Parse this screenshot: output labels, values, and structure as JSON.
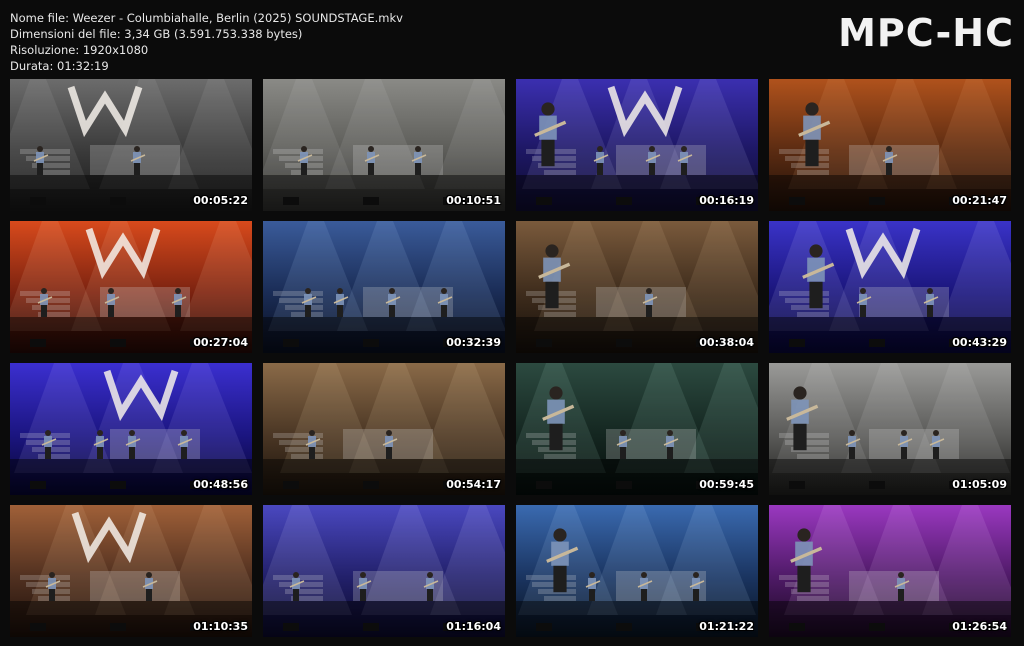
{
  "info": {
    "filename": "Nome file: Weezer - Columbiahalle, Berlin (2025) SOUNDSTAGE.mkv",
    "filesize": "Dimensioni del file: 3,34 GB (3.591.753.338 bytes)",
    "resolution": "Risoluzione: 1920x1080",
    "duration": "Durata: 01:32:19"
  },
  "logo": "MPC-HC",
  "thumbnails": [
    {
      "time": "00:05:22",
      "palette": "grey",
      "top": "#6c6c6c",
      "mid": "#3a3a3a",
      "bottom": "#161616",
      "accent": "#bdbdbd"
    },
    {
      "time": "00:10:51",
      "palette": "grey",
      "top": "#8a8a86",
      "mid": "#5c5c58",
      "bottom": "#2a2a28",
      "accent": "#cfcfcf"
    },
    {
      "time": "00:16:19",
      "palette": "blue",
      "top": "#3b2fb0",
      "mid": "#1d1763",
      "bottom": "#0d0b2c",
      "accent": "#c9c6ff"
    },
    {
      "time": "00:21:47",
      "palette": "orange",
      "top": "#b0521c",
      "mid": "#5a2b12",
      "bottom": "#1c0e07",
      "accent": "#f0b07a"
    },
    {
      "time": "00:27:04",
      "palette": "red",
      "top": "#d84a1c",
      "mid": "#7a2210",
      "bottom": "#220906",
      "accent": "#ffd0b0"
    },
    {
      "time": "00:32:39",
      "palette": "blue",
      "top": "#3a5b9a",
      "mid": "#1a2c55",
      "bottom": "#080d1c",
      "accent": "#b9d2ff"
    },
    {
      "time": "00:38:04",
      "palette": "brown",
      "top": "#7a5a3c",
      "mid": "#3e2c1c",
      "bottom": "#140e09",
      "accent": "#e8c8a0"
    },
    {
      "time": "00:43:29",
      "palette": "violet",
      "top": "#3a33c8",
      "mid": "#1a157a",
      "bottom": "#070632",
      "accent": "#d0ccff"
    },
    {
      "time": "00:48:56",
      "palette": "violet",
      "top": "#3b2fd0",
      "mid": "#1b1580",
      "bottom": "#06052e",
      "accent": "#bdb7ff"
    },
    {
      "time": "00:54:17",
      "palette": "brown",
      "top": "#8a6a48",
      "mid": "#4a3624",
      "bottom": "#1a120a",
      "accent": "#f0d2aa"
    },
    {
      "time": "00:59:45",
      "palette": "teal",
      "top": "#2c4a40",
      "mid": "#142620",
      "bottom": "#050c0a",
      "accent": "#b0e0cc"
    },
    {
      "time": "01:05:09",
      "palette": "grey",
      "top": "#9a9a98",
      "mid": "#5a5a58",
      "bottom": "#1e1e1c",
      "accent": "#e0e0e0"
    },
    {
      "time": "01:10:35",
      "palette": "orange",
      "top": "#a06038",
      "mid": "#503020",
      "bottom": "#1a0e08",
      "accent": "#f2c8a0"
    },
    {
      "time": "01:16:04",
      "palette": "blue",
      "top": "#4a48c0",
      "mid": "#22206a",
      "bottom": "#0a0928",
      "accent": "#d8d6ff"
    },
    {
      "time": "01:21:22",
      "palette": "blue",
      "top": "#3a6ab0",
      "mid": "#1a3460",
      "bottom": "#08121e",
      "accent": "#c0dcff"
    },
    {
      "time": "01:26:54",
      "palette": "purple",
      "top": "#9a38c0",
      "mid": "#4e1a66",
      "bottom": "#18081e",
      "accent": "#f0c8ff"
    }
  ]
}
